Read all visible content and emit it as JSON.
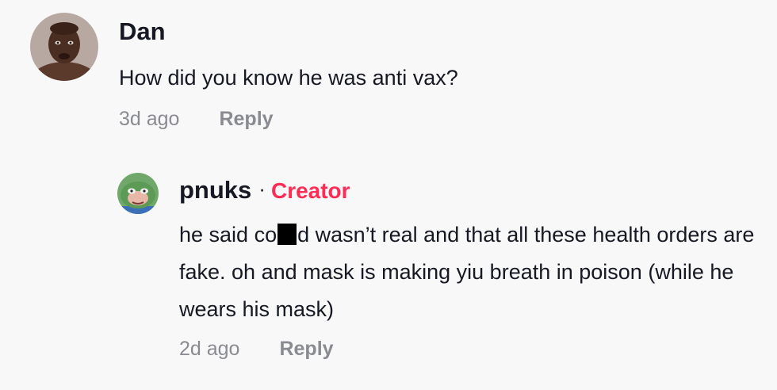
{
  "comments": [
    {
      "username": "Dan",
      "avatar_icon": "user-photo-avatar",
      "text": "How did you know he was anti vax?",
      "age": "3d ago",
      "reply_label": "Reply"
    },
    {
      "username": "pnuks",
      "separator": "·",
      "badge": "Creator",
      "text_before_redaction": "he said co",
      "text_after_redaction": "d wasn’t real and that all these health orders are fake. oh and mask is making yiu breath in poison (while he wears his mask)",
      "avatar_icon": "frog-avatar",
      "age": "2d ago",
      "reply_label": "Reply"
    }
  ],
  "colors": {
    "background": "#f8f8f8",
    "text": "#161823",
    "muted": "#8a8b91",
    "creator_badge": "#fe2c55"
  }
}
